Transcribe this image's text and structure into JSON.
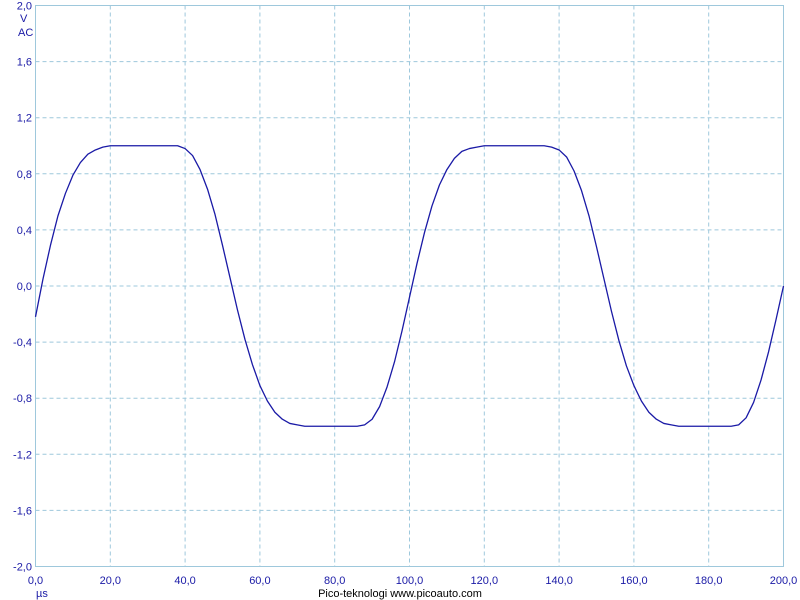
{
  "chart_data": {
    "type": "line",
    "title": "",
    "xlabel": "",
    "x_unit": "µs",
    "y_unit": "V",
    "coupling": "AC",
    "xlim": [
      0,
      200
    ],
    "ylim": [
      -2.0,
      2.0
    ],
    "x_ticks": [
      "0,0",
      "20,0",
      "40,0",
      "60,0",
      "80,0",
      "100,0",
      "120,0",
      "140,0",
      "160,0",
      "180,0",
      "200,0"
    ],
    "y_ticks": [
      "2,0",
      "1,6",
      "1,2",
      "0,8",
      "0,4",
      "0,0",
      "-0,4",
      "-0,8",
      "-1,2",
      "-1,6",
      "-2,0"
    ],
    "grid": true,
    "series": [
      {
        "color": "#1a1aa6",
        "x": [
          0,
          2,
          4,
          6,
          8,
          10,
          12,
          14,
          16,
          18,
          20,
          22,
          24,
          26,
          28,
          30,
          32,
          34,
          36,
          38,
          40,
          42,
          44,
          46,
          48,
          50,
          52,
          54,
          56,
          58,
          60,
          62,
          64,
          66,
          68,
          70,
          72,
          74,
          76,
          78,
          80,
          82,
          84,
          86,
          88,
          90,
          92,
          94,
          96,
          98,
          100,
          102,
          104,
          106,
          108,
          110,
          112,
          114,
          116,
          118,
          120,
          122,
          124,
          126,
          128,
          130,
          132,
          134,
          136,
          138,
          140,
          142,
          144,
          146,
          148,
          150,
          152,
          154,
          156,
          158,
          160,
          162,
          164,
          166,
          168,
          170,
          172,
          174,
          176,
          178,
          180,
          182,
          184,
          186,
          188,
          190,
          192,
          194,
          196,
          198,
          200
        ],
        "values": [
          -0.22,
          0.05,
          0.29,
          0.5,
          0.66,
          0.79,
          0.88,
          0.94,
          0.97,
          0.99,
          1.0,
          1.0,
          1.0,
          1.0,
          1.0,
          1.0,
          1.0,
          1.0,
          1.0,
          1.0,
          0.98,
          0.93,
          0.83,
          0.69,
          0.51,
          0.29,
          0.06,
          -0.17,
          -0.38,
          -0.56,
          -0.71,
          -0.82,
          -0.9,
          -0.95,
          -0.98,
          -0.99,
          -1.0,
          -1.0,
          -1.0,
          -1.0,
          -1.0,
          -1.0,
          -1.0,
          -1.0,
          -0.99,
          -0.95,
          -0.86,
          -0.72,
          -0.54,
          -0.32,
          -0.08,
          0.16,
          0.38,
          0.57,
          0.72,
          0.83,
          0.91,
          0.96,
          0.98,
          0.99,
          1.0,
          1.0,
          1.0,
          1.0,
          1.0,
          1.0,
          1.0,
          1.0,
          1.0,
          0.99,
          0.97,
          0.92,
          0.82,
          0.68,
          0.5,
          0.28,
          0.05,
          -0.18,
          -0.39,
          -0.57,
          -0.71,
          -0.82,
          -0.9,
          -0.95,
          -0.98,
          -0.99,
          -1.0,
          -1.0,
          -1.0,
          -1.0,
          -1.0,
          -1.0,
          -1.0,
          -1.0,
          -0.99,
          -0.94,
          -0.83,
          -0.67,
          -0.47,
          -0.24,
          0.0
        ]
      }
    ]
  },
  "footer": {
    "credit": "Pico-teknologi  www.picoauto.com"
  }
}
